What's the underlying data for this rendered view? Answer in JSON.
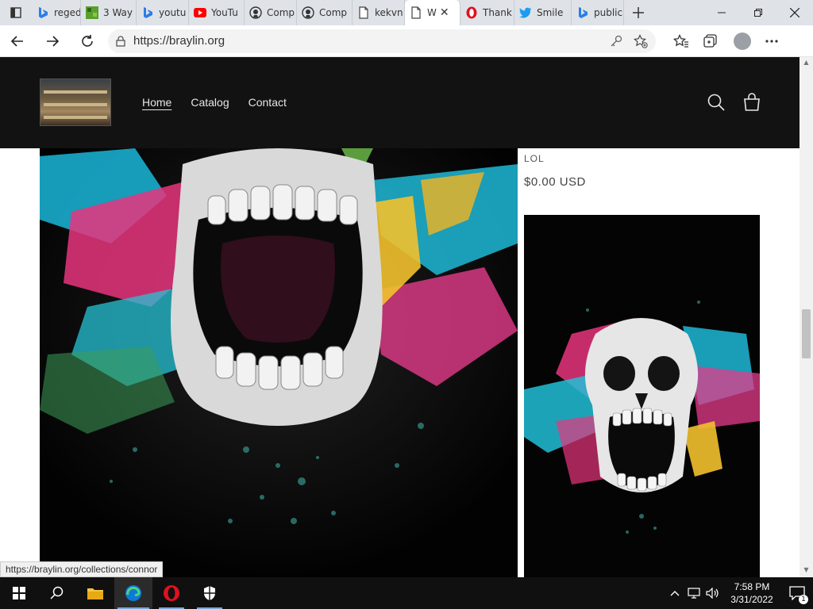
{
  "browser": {
    "tabs": [
      {
        "label": "reged",
        "icon": "bing-icon",
        "active": false
      },
      {
        "label": "3 Way",
        "icon": "minecraft-icon",
        "active": false
      },
      {
        "label": "youtu",
        "icon": "bing-icon",
        "active": false
      },
      {
        "label": "YouTu",
        "icon": "youtube-icon",
        "active": false
      },
      {
        "label": "Comp",
        "icon": "github-icon",
        "active": false
      },
      {
        "label": "Comp",
        "icon": "github-icon",
        "active": false
      },
      {
        "label": "kekvn",
        "icon": "page-icon",
        "active": false
      },
      {
        "label": "W",
        "icon": "page-icon",
        "active": true
      },
      {
        "label": "Thank",
        "icon": "opera-icon",
        "active": false
      },
      {
        "label": "Smile",
        "icon": "twitter-icon",
        "active": false
      },
      {
        "label": "public",
        "icon": "bing-icon",
        "active": false
      }
    ],
    "url": "https://braylin.org",
    "status_link": "https://braylin.org/collections/connor"
  },
  "site": {
    "nav": [
      {
        "label": "Home",
        "active": true
      },
      {
        "label": "Catalog",
        "active": false
      },
      {
        "label": "Contact",
        "active": false
      }
    ]
  },
  "product": {
    "vendor": "LOL",
    "price": "$0.00 USD"
  },
  "taskbar": {
    "time": "7:58 PM",
    "date": "3/31/2022",
    "notification_count": "1"
  },
  "colors": {
    "header_bg": "#121212",
    "accent": "#0078d7",
    "youtube_red": "#ff0000",
    "twitter_blue": "#1d9bf0",
    "bing_blue": "#2b7de9"
  }
}
